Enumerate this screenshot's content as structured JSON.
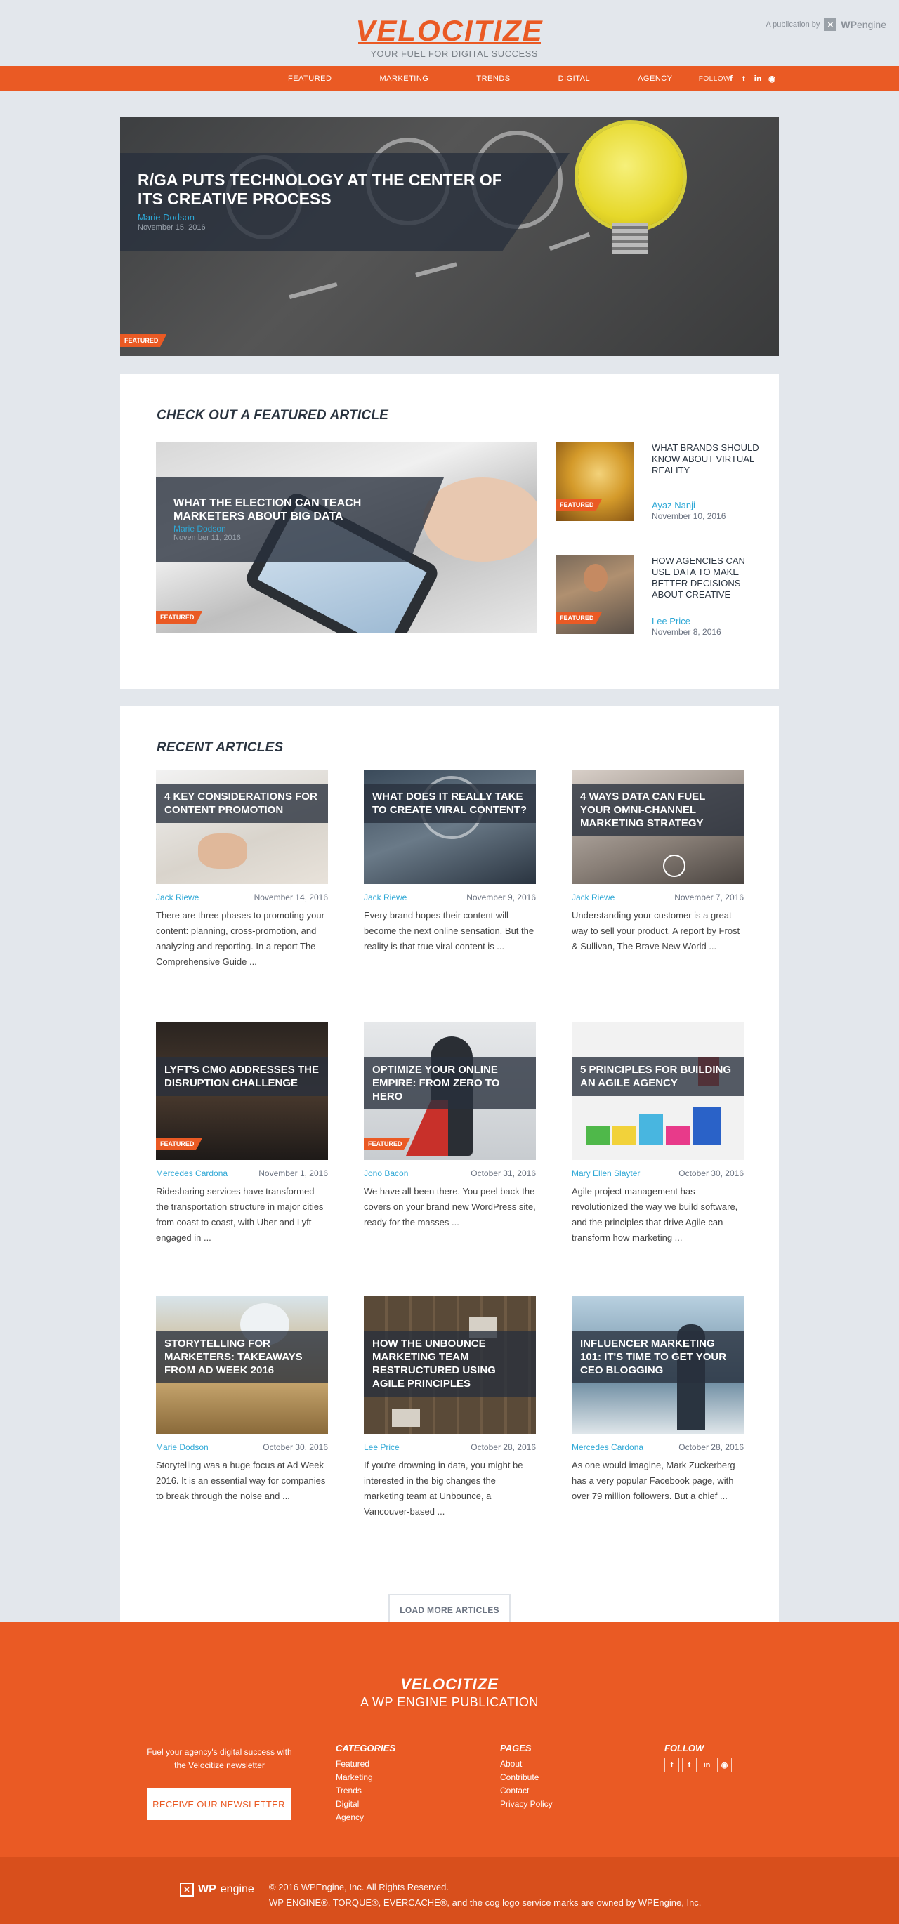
{
  "brand": {
    "name": "VELOCITIZE",
    "tagline": "YOUR FUEL FOR DIGITAL SUCCESS",
    "publication": "A publication by",
    "wp": "WP",
    "engine": "engine",
    "accent": "#ea5a24",
    "link": "#2ea8d6"
  },
  "nav": {
    "items": [
      "FEATURED",
      "MARKETING",
      "TRENDS",
      "DIGITAL",
      "AGENCY"
    ],
    "follow": "FOLLOW",
    "social": [
      "facebook-icon",
      "twitter-icon",
      "linkedin-icon",
      "rss-icon"
    ],
    "social_glyphs": [
      "f",
      "t",
      "in",
      "rss"
    ]
  },
  "hero": {
    "title": "R/GA PUTS TECHNOLOGY AT THE CENTER OF ITS CREATIVE PROCESS",
    "author": "Marie Dodson",
    "date": "November 15, 2016",
    "badge": "FEATURED"
  },
  "featured": {
    "heading": "CHECK OUT A FEATURED ARTICLE",
    "main": {
      "title": "WHAT THE ELECTION CAN TEACH MARKETERS ABOUT BIG DATA",
      "author": "Marie Dodson",
      "date": "November 11, 2016",
      "badge": "FEATURED"
    },
    "side": [
      {
        "title": "WHAT BRANDS SHOULD KNOW ABOUT VIRTUAL REALITY",
        "author": "Ayaz Nanji",
        "date": "November 10, 2016",
        "badge": "FEATURED"
      },
      {
        "title": "HOW AGENCIES CAN USE DATA TO MAKE BETTER DECISIONS ABOUT CREATIVE",
        "author": "Lee Price",
        "date": "November 8, 2016",
        "badge": "FEATURED"
      }
    ]
  },
  "recent": {
    "heading": "RECENT ARTICLES",
    "articles": [
      {
        "title": "4 KEY CONSIDERATIONS FOR CONTENT PROMOTION",
        "author": "Jack Riewe",
        "date": "November 14, 2016",
        "excerpt": "There are three phases to promoting your content: planning, cross-promotion, and analyzing and reporting. In a report The Comprehensive Guide ...",
        "badge": ""
      },
      {
        "title": "WHAT DOES IT REALLY TAKE TO CREATE VIRAL CONTENT?",
        "author": "Jack Riewe",
        "date": "November 9, 2016",
        "excerpt": "Every brand hopes their content will become the next online sensation. But the reality is that true viral content is ...",
        "badge": ""
      },
      {
        "title": "4 WAYS DATA CAN FUEL YOUR OMNI-CHANNEL MARKETING STRATEGY",
        "author": "Jack Riewe",
        "date": "November 7, 2016",
        "excerpt": "Understanding your customer is a great way to sell your product. A report by Frost & Sullivan, The Brave New World ...",
        "badge": ""
      },
      {
        "title": "LYFT'S CMO ADDRESSES THE DISRUPTION CHALLENGE",
        "author": "Mercedes Cardona",
        "date": "November 1, 2016",
        "excerpt": "Ridesharing services have transformed the transportation structure in major cities from coast to coast, with Uber and Lyft engaged in ...",
        "badge": "FEATURED"
      },
      {
        "title": "OPTIMIZE YOUR ONLINE EMPIRE: FROM ZERO TO HERO",
        "author": "Jono Bacon",
        "date": "October 31, 2016",
        "excerpt": "We have all been there. You peel back the covers on your brand new WordPress site, ready for the masses ...",
        "badge": "FEATURED"
      },
      {
        "title": "5 PRINCIPLES FOR BUILDING AN AGILE AGENCY",
        "author": "Mary Ellen Slayter",
        "date": "October 30, 2016",
        "excerpt": "Agile project management has revolutionized the way we build software, and the principles that drive Agile can transform how marketing ...",
        "badge": ""
      },
      {
        "title": "STORYTELLING FOR MARKETERS: TAKEAWAYS FROM AD WEEK 2016",
        "author": "Marie Dodson",
        "date": "October 30, 2016",
        "excerpt": "Storytelling was a huge focus at Ad Week 2016. It is an essential way for companies to break through the noise and ...",
        "badge": ""
      },
      {
        "title": "HOW THE UNBOUNCE MARKETING TEAM RESTRUCTURED USING AGILE PRINCIPLES",
        "author": "Lee Price",
        "date": "October 28, 2016",
        "excerpt": "If you're drowning in data, you might be interested in the big changes the marketing team at Unbounce, a Vancouver-based ...",
        "badge": ""
      },
      {
        "title": "INFLUENCER MARKETING 101: IT'S TIME TO GET YOUR CEO BLOGGING",
        "author": "Mercedes Cardona",
        "date": "October 28, 2016",
        "excerpt": "As one would imagine, Mark Zuckerberg has a very popular Facebook page, with over 79 million followers. But a chief ...",
        "badge": ""
      }
    ],
    "load_more": "LOAD MORE ARTICLES"
  },
  "footer": {
    "logo": "VELOCITIZE",
    "publication": "A WP ENGINE PUBLICATION",
    "newsletter_text": "Fuel your agency's digital success with the Velocitize newsletter",
    "newsletter_button": "RECEIVE OUR NEWSLETTER",
    "categories": {
      "heading": "CATEGORIES",
      "items": [
        "Featured",
        "Marketing",
        "Trends",
        "Digital",
        "Agency"
      ]
    },
    "pages": {
      "heading": "PAGES",
      "items": [
        "About",
        "Contribute",
        "Contact",
        "Privacy Policy"
      ]
    },
    "follow": {
      "heading": "FOLLOW"
    },
    "copyright": "© 2016 WPEngine, Inc. All Rights Reserved.",
    "trademark": "WP ENGINE®, TORQUE®, EVERCACHE®, and the cog logo service marks are owned by WPEngine, Inc."
  }
}
